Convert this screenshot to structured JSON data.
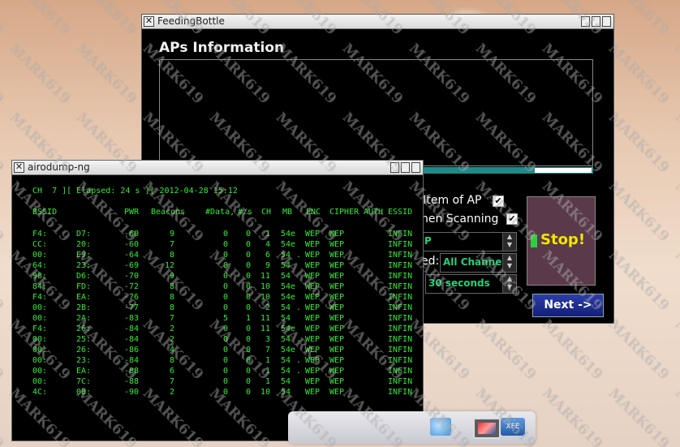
{
  "feeding_bottle": {
    "title": "FeedingBottle",
    "aps_title": "APs Information",
    "option1_label": "r Item of AP",
    "option1_checked": "✔",
    "option2_label": "hen Scanning",
    "option2_checked": "✔",
    "combo1_value": "P",
    "channel_label": "ed:",
    "channel_value": "All Channel",
    "interval_value": "30 seconds",
    "stop_label": "Stop!",
    "next_label": "Next ->",
    "progress": 0.87
  },
  "airodump": {
    "title": "airodump-ng",
    "status_line": "CH  7 ][ Elapsed: 24 s ][ 2012-04-28 15:12",
    "headers": [
      "BSSID",
      "PWR",
      "Beacons",
      "#Data,",
      "#/s",
      "CH",
      "MB",
      "ENC",
      "CIPHER",
      "AUTH",
      "ESSID"
    ],
    "rows": [
      {
        "b1": "F4:",
        "b2": "D7:",
        "pwr": "-60",
        "beacons": "9",
        "data": "0",
        "ps": "0",
        "ch": "1",
        "mb": "54e",
        "dot": "",
        "enc": "WEP",
        "cipher": "WEP",
        "essid": "INFIN"
      },
      {
        "b1": "CC:",
        "b2": "20:",
        "pwr": "-60",
        "beacons": "7",
        "data": "0",
        "ps": "0",
        "ch": "4",
        "mb": "54e",
        "dot": "",
        "enc": "WEP",
        "cipher": "WEP",
        "essid": "INFIN"
      },
      {
        "b1": "00:",
        "b2": "E9:",
        "pwr": "-64",
        "beacons": "8",
        "data": "0",
        "ps": "0",
        "ch": "6",
        "mb": "54",
        "dot": ".",
        "enc": "WEP",
        "cipher": "WEP",
        "essid": "INFIN"
      },
      {
        "b1": "64:",
        "b2": "23:",
        "pwr": "-69",
        "beacons": "12",
        "data": "0",
        "ps": "0",
        "ch": "9",
        "mb": "54",
        "dot": "",
        "enc": "WEP",
        "cipher": "WEP",
        "essid": "INFIN"
      },
      {
        "b1": "98:",
        "b2": "D6:",
        "pwr": "-70",
        "beacons": "9",
        "data": "0",
        "ps": "0",
        "ch": "11",
        "mb": "54",
        "dot": "",
        "enc": "WEP",
        "cipher": "WEP",
        "essid": "INFIN"
      },
      {
        "b1": "84:",
        "b2": "FD:",
        "pwr": "-72",
        "beacons": "8",
        "data": "0",
        "ps": "0",
        "ch": "10",
        "mb": "54e",
        "dot": "",
        "enc": "WEP",
        "cipher": "WEP",
        "essid": "INFIN"
      },
      {
        "b1": "F4:",
        "b2": "EA:",
        "pwr": "-76",
        "beacons": "8",
        "data": "0",
        "ps": "0",
        "ch": "10",
        "mb": "54e",
        "dot": "",
        "enc": "WEP",
        "cipher": "WEP",
        "essid": "INFIN"
      },
      {
        "b1": "00:",
        "b2": "2B:",
        "pwr": "-77",
        "beacons": "8",
        "data": "0",
        "ps": "0",
        "ch": "2",
        "mb": "54",
        "dot": ".",
        "enc": "WEP",
        "cipher": "WEP",
        "essid": "INFIN"
      },
      {
        "b1": "00:",
        "b2": "2A:",
        "pwr": "-83",
        "beacons": "7",
        "data": "5",
        "ps": "1",
        "ch": "11",
        "mb": "54",
        "dot": "",
        "enc": "WEP",
        "cipher": "WEP",
        "essid": "INFIN"
      },
      {
        "b1": "F4:",
        "b2": "26:",
        "pwr": "-84",
        "beacons": "2",
        "data": "0",
        "ps": "0",
        "ch": "11",
        "mb": "54e",
        "dot": "",
        "enc": "WEP",
        "cipher": "WEP",
        "essid": "INFIN"
      },
      {
        "b1": "00:",
        "b2": "25:",
        "pwr": "-84",
        "beacons": "2",
        "data": "0",
        "ps": "0",
        "ch": "3",
        "mb": "54",
        "dot": ".",
        "enc": "WEP",
        "cipher": "WEP",
        "essid": "INFIN"
      },
      {
        "b1": "00:",
        "b2": "26:",
        "pwr": "-86",
        "beacons": "4",
        "data": "0",
        "ps": "0",
        "ch": "7",
        "mb": "54e",
        "dot": "",
        "enc": "WEP",
        "cipher": "WEP",
        "essid": "INFIN"
      },
      {
        "b1": "00:",
        "b2": "23:",
        "pwr": "-84",
        "beacons": "8",
        "data": "0",
        "ps": "0",
        "ch": "1",
        "mb": "54",
        "dot": ".",
        "enc": "WEP",
        "cipher": "WEP",
        "essid": "INFIN"
      },
      {
        "b1": "00:",
        "b2": "EA:",
        "pwr": "-88",
        "beacons": "6",
        "data": "0",
        "ps": "0",
        "ch": "1",
        "mb": "54",
        "dot": ".",
        "enc": "WEP",
        "cipher": "WEP",
        "essid": "INFIN"
      },
      {
        "b1": "00:",
        "b2": "7C:",
        "pwr": "-88",
        "beacons": "7",
        "data": "0",
        "ps": "0",
        "ch": "1",
        "mb": "54",
        "dot": "",
        "enc": "WEP",
        "cipher": "WEP",
        "essid": "INFIN"
      },
      {
        "b1": "4C:",
        "b2": "0B:",
        "pwr": "-90",
        "beacons": "2",
        "data": "0",
        "ps": "0",
        "ch": "10",
        "mb": "54",
        "dot": "",
        "enc": "WEP",
        "cipher": "WEP",
        "essid": "INFIN"
      }
    ]
  },
  "taskbar": {
    "xfe_label": "XFE"
  },
  "watermark": "MARK619"
}
